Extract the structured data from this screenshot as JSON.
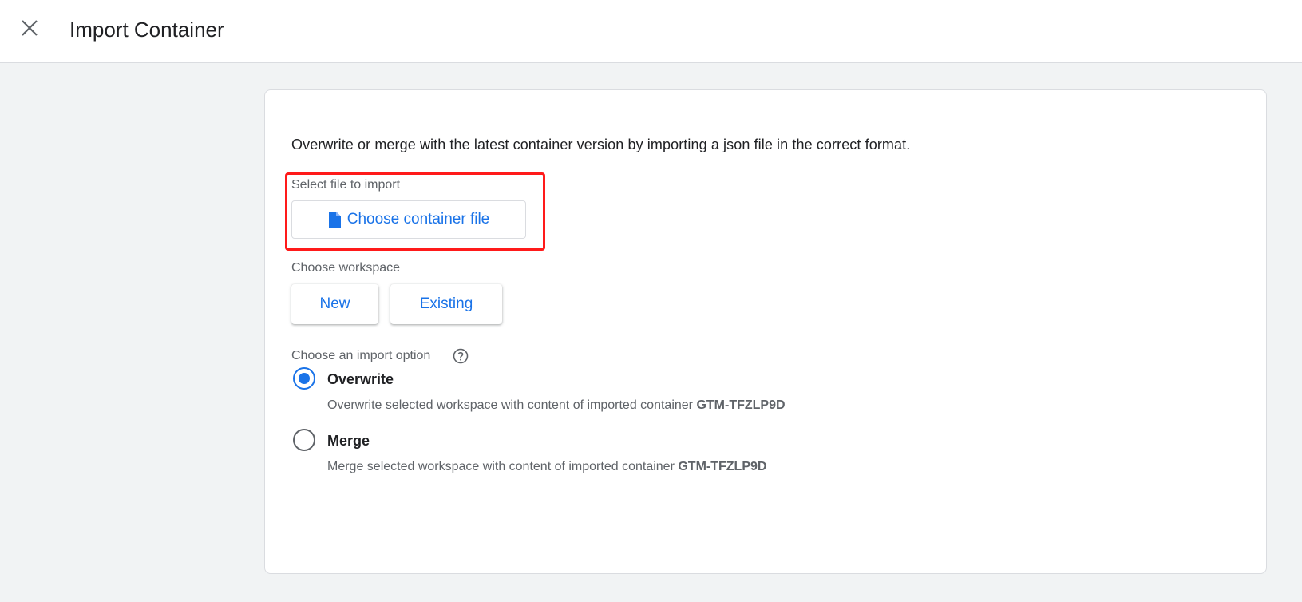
{
  "header": {
    "title": "Import Container",
    "close_icon": "close-icon"
  },
  "main": {
    "intro_text": "Overwrite or merge with the latest container version by importing a json file in the correct format.",
    "file_section": {
      "label": "Select file to import",
      "button_label": "Choose container file",
      "button_icon": "document-icon"
    },
    "workspace_section": {
      "label": "Choose workspace",
      "buttons": [
        "New",
        "Existing"
      ]
    },
    "import_option_section": {
      "label": "Choose an import option",
      "help_icon": "help-icon",
      "options": [
        {
          "title": "Overwrite",
          "description": "Overwrite selected workspace with content of imported container",
          "container_id": "GTM-TFZLP9D",
          "selected": true
        },
        {
          "title": "Merge",
          "description": "Merge selected workspace with content of imported container",
          "container_id": "GTM-TFZLP9D",
          "selected": false
        }
      ]
    }
  },
  "colors": {
    "accent": "#1a73e8",
    "highlight": "#ff1a1a",
    "background": "#f1f3f4"
  }
}
